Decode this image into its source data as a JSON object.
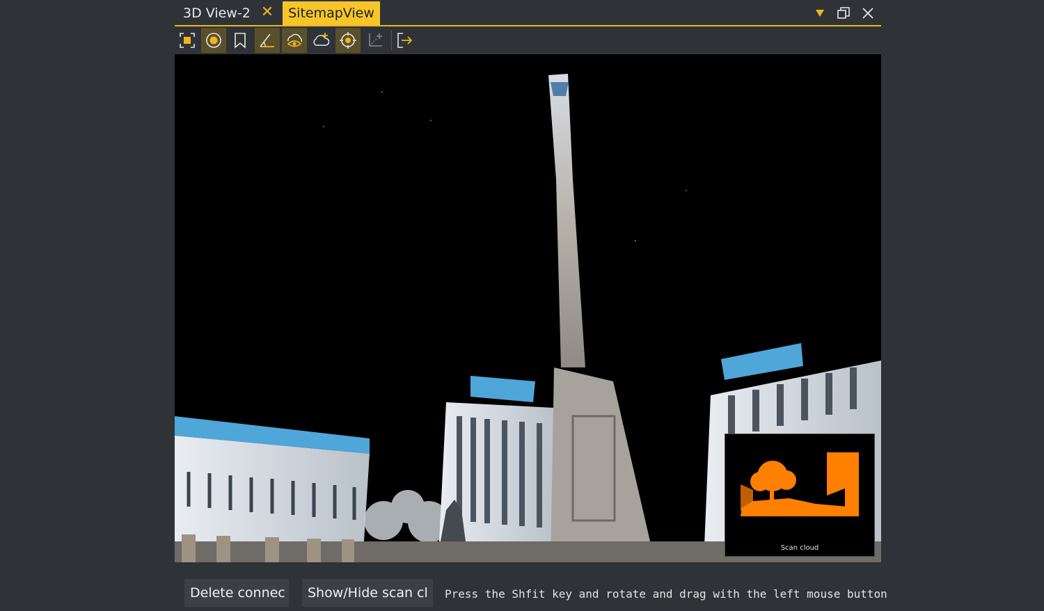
{
  "tabs": [
    {
      "label": "3D View-2",
      "active": false
    },
    {
      "label": "SitemapView",
      "active": true
    }
  ],
  "window_controls": [
    "dropdown-arrow-icon",
    "restore-icon",
    "close-icon"
  ],
  "toolbar": {
    "icons": [
      "fit-view-icon",
      "target-circle-icon",
      "bookmark-icon",
      "angle-measure-icon",
      "eye-cloud-icon",
      "cloud-add-icon",
      "crosshair-icon",
      "axis-icon",
      "exit-icon"
    ]
  },
  "minimap": {
    "label": "Scan cloud"
  },
  "bottom": {
    "delete_label": "Delete connec",
    "showhide_label": "Show/Hide scan cl",
    "hint": "Press the Shfit key and rotate and drag with the left mouse button"
  },
  "colors": {
    "accent": "#f7c52a",
    "background": "#2f3337",
    "minimap_fill": "#ff7f00"
  }
}
